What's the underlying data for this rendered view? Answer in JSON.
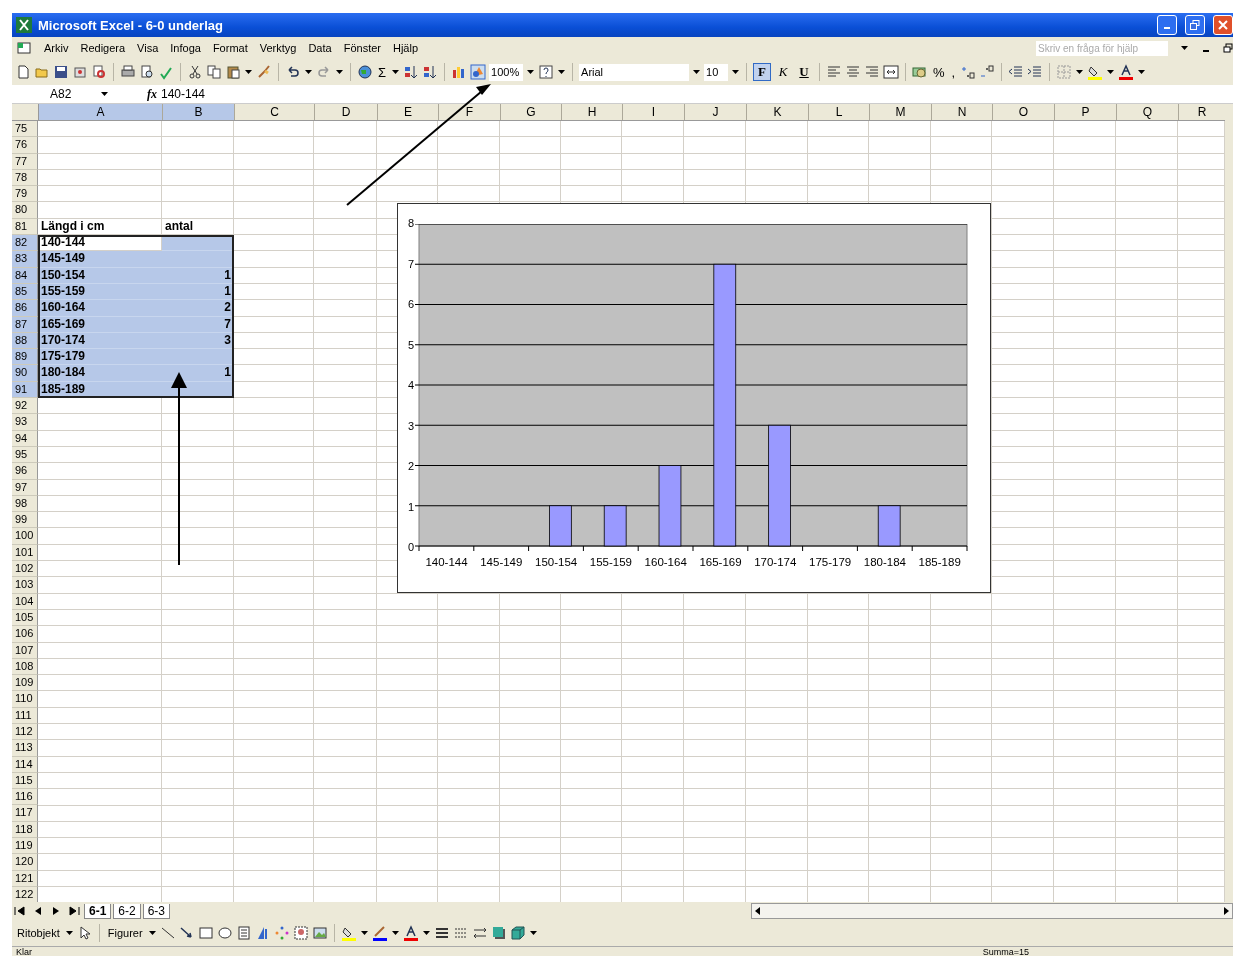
{
  "window": {
    "title": "Microsoft Excel - 6-0 underlag"
  },
  "menu": [
    "Arkiv",
    "Redigera",
    "Visa",
    "Infoga",
    "Format",
    "Verktyg",
    "Data",
    "Fönster",
    "Hjälp"
  ],
  "help_box": {
    "placeholder": "Skriv en fråga för hjälp"
  },
  "toolbar": {
    "sum": "Σ",
    "zoom": "100%",
    "font": "Arial",
    "size": "10",
    "percent": "%",
    "comma": ",",
    "format_buttons": [
      {
        "label": "F",
        "selected": true
      },
      {
        "label": "K",
        "selected": false
      },
      {
        "label": "U",
        "selected": false
      }
    ]
  },
  "formula_bar": {
    "name_box": "A82",
    "function_label": "fx",
    "value": "140-144"
  },
  "columns": [
    {
      "label": "A",
      "selected": true
    },
    {
      "label": "B",
      "selected": true
    },
    {
      "label": "C",
      "selected": false
    },
    {
      "label": "D",
      "selected": false
    },
    {
      "label": "E",
      "selected": false
    },
    {
      "label": "F",
      "selected": false
    },
    {
      "label": "G",
      "selected": false
    },
    {
      "label": "H",
      "selected": false
    },
    {
      "label": "I",
      "selected": false
    },
    {
      "label": "J",
      "selected": false
    },
    {
      "label": "K",
      "selected": false
    },
    {
      "label": "L",
      "selected": false
    },
    {
      "label": "M",
      "selected": false
    },
    {
      "label": "N",
      "selected": false
    },
    {
      "label": "O",
      "selected": false
    },
    {
      "label": "P",
      "selected": false
    },
    {
      "label": "Q",
      "selected": false
    },
    {
      "label": "R",
      "selected": false
    }
  ],
  "rows": [
    {
      "number": "75",
      "selected": false
    },
    {
      "number": "76",
      "selected": false
    },
    {
      "number": "77",
      "selected": false
    },
    {
      "number": "78",
      "selected": false
    },
    {
      "number": "79",
      "selected": false
    },
    {
      "number": "80",
      "selected": false
    },
    {
      "number": "81",
      "selected": false,
      "column_a": "Längd i cm",
      "column_b": "antal"
    },
    {
      "number": "82",
      "selected": true,
      "active": true,
      "column_a": "140-144"
    },
    {
      "number": "83",
      "selected": true,
      "active": false,
      "column_a": "145-149"
    },
    {
      "number": "84",
      "selected": true,
      "active": false,
      "column_a": "150-154",
      "column_b": "1"
    },
    {
      "number": "85",
      "selected": true,
      "active": false,
      "column_a": "155-159",
      "column_b": "1"
    },
    {
      "number": "86",
      "selected": true,
      "active": false,
      "column_a": "160-164",
      "column_b": "2"
    },
    {
      "number": "87",
      "selected": true,
      "active": false,
      "column_a": "165-169",
      "column_b": "7"
    },
    {
      "number": "88",
      "selected": true,
      "active": false,
      "column_a": "170-174",
      "column_b": "3"
    },
    {
      "number": "89",
      "selected": true,
      "active": false,
      "column_a": "175-179"
    },
    {
      "number": "90",
      "selected": true,
      "active": false,
      "column_a": "180-184",
      "column_b": "1"
    },
    {
      "number": "91",
      "selected": true,
      "active": false,
      "column_a": "185-189"
    },
    {
      "number": "92",
      "selected": false
    },
    {
      "number": "93",
      "selected": false
    },
    {
      "number": "94",
      "selected": false
    },
    {
      "number": "95",
      "selected": false
    },
    {
      "number": "96",
      "selected": false
    },
    {
      "number": "97",
      "selected": false
    },
    {
      "number": "98",
      "selected": false
    },
    {
      "number": "99",
      "selected": false
    },
    {
      "number": "100",
      "selected": false
    },
    {
      "number": "101",
      "selected": false
    },
    {
      "number": "102",
      "selected": false
    },
    {
      "number": "103",
      "selected": false
    },
    {
      "number": "104",
      "selected": false
    },
    {
      "number": "105",
      "selected": false
    },
    {
      "number": "106",
      "selected": false
    },
    {
      "number": "107",
      "selected": false
    },
    {
      "number": "108",
      "selected": false
    },
    {
      "number": "109",
      "selected": false
    },
    {
      "number": "110",
      "selected": false
    },
    {
      "number": "111",
      "selected": false
    },
    {
      "number": "112",
      "selected": false
    },
    {
      "number": "113",
      "selected": false
    },
    {
      "number": "114",
      "selected": false
    },
    {
      "number": "115",
      "selected": false
    },
    {
      "number": "116",
      "selected": false
    },
    {
      "number": "117",
      "selected": false
    },
    {
      "number": "118",
      "selected": false
    },
    {
      "number": "119",
      "selected": false
    },
    {
      "number": "120",
      "selected": false
    },
    {
      "number": "121",
      "selected": false
    },
    {
      "number": "122",
      "selected": false
    }
  ],
  "chart": {
    "chart_data": {
      "type": "bar",
      "categories": [
        "140-144",
        "145-149",
        "150-154",
        "155-159",
        "160-164",
        "165-169",
        "170-174",
        "175-179",
        "180-184",
        "185-189"
      ],
      "series": [
        {
          "color": "#9999ff",
          "values": [
            null,
            null,
            1,
            1,
            2,
            7,
            3,
            null,
            1,
            null
          ]
        }
      ],
      "ylim": [
        0,
        8
      ],
      "yticks": [
        0,
        1,
        2,
        3,
        4,
        5,
        6,
        7,
        8
      ],
      "grid": true
    }
  },
  "sheet_tabs": [
    {
      "label": "6-1",
      "selected": true
    },
    {
      "label": "6-2",
      "selected": false
    },
    {
      "label": "6-3",
      "selected": false
    }
  ],
  "drawing_toolbar": {
    "draw_menu": "Ritobjekt",
    "shapes_menu": "Figurer"
  },
  "status_bar": {
    "status": "Klar",
    "sum": "Summa=15"
  }
}
